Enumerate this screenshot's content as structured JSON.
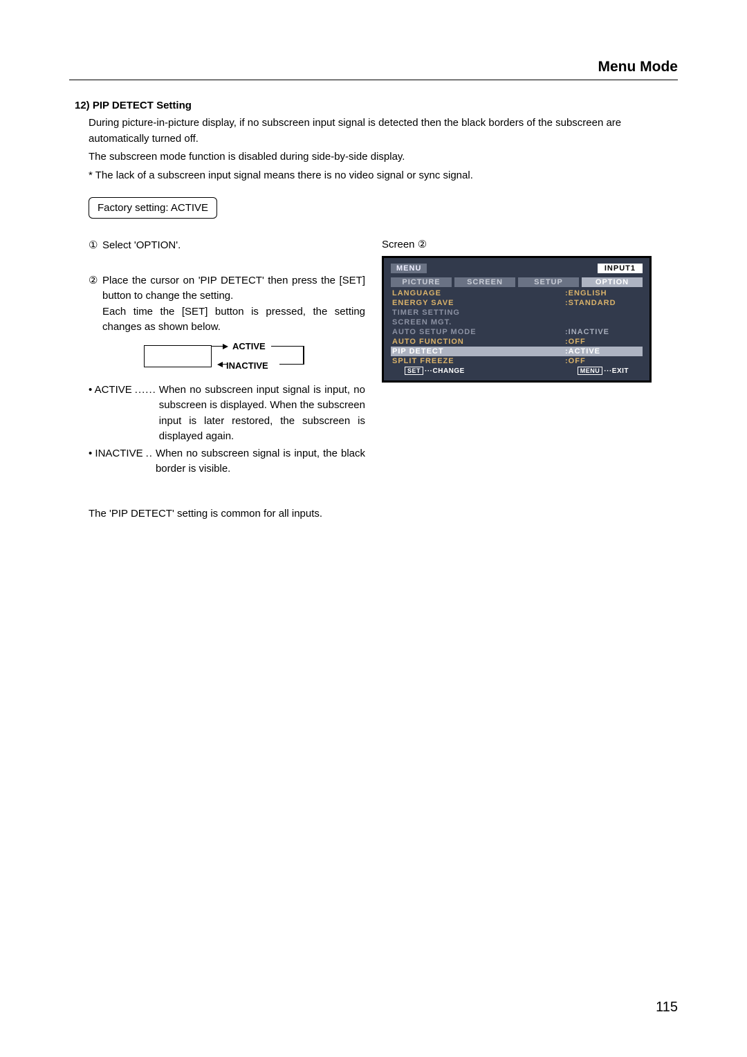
{
  "header": {
    "title": "Menu Mode"
  },
  "section": {
    "heading": "12) PIP DETECT Setting",
    "p1": "During picture-in-picture display, if no subscreen input signal is detected then the black borders of the subscreen are automatically turned off.",
    "p2": "The subscreen mode function is disabled during side-by-side display.",
    "p3": "* The lack of a subscreen input signal means there is no video signal or sync signal.",
    "factory": "Factory setting:  ACTIVE"
  },
  "steps": {
    "s1": {
      "num": "①",
      "text": "Select 'OPTION'."
    },
    "s2": {
      "num": "②",
      "l1": "Place the cursor on 'PIP DETECT' then press the [SET] button to change the setting.",
      "l2": "Each time the [SET] button is pressed, the setting changes as shown below."
    }
  },
  "cycle": {
    "top": "ACTIVE",
    "bottom": "INACTIVE"
  },
  "bullets": {
    "active": {
      "term": "• ACTIVE",
      "dots": "......",
      "def": "When no subscreen input signal is input, no subscreen is displayed. When the subscreen input is later restored, the subscreen is displayed again."
    },
    "inactive": {
      "term": "• INACTIVE",
      "dots": "..",
      "def": "When no subscreen signal is input, the black border is visible."
    }
  },
  "common_note": "The 'PIP DETECT' setting is common for all inputs.",
  "screen_label": "Screen ②",
  "osd": {
    "menu": "MENU",
    "input": "INPUT1",
    "tabs": [
      "PICTURE",
      "SCREEN",
      "SETUP",
      "OPTION"
    ],
    "rows": [
      {
        "k": "LANGUAGE",
        "v": ":ENGLISH",
        "style": "orange"
      },
      {
        "k": "ENERGY SAVE",
        "v": ":STANDARD",
        "style": "orange"
      },
      {
        "k": "TIMER SETTING",
        "v": "",
        "style": ""
      },
      {
        "k": "SCREEN MGT.",
        "v": "",
        "style": ""
      },
      {
        "k": "AUTO SETUP MODE",
        "v": ":INACTIVE",
        "style": ""
      },
      {
        "k": "AUTO FUNCTION",
        "v": ":OFF",
        "style": "orange"
      },
      {
        "k": "PIP DETECT",
        "v": ":ACTIVE",
        "style": "hl"
      },
      {
        "k": "SPLIT FREEZE",
        "v": ":OFF",
        "style": "orange"
      }
    ],
    "footer": {
      "left_btn": "SET",
      "left": "···CHANGE",
      "right_btn": "MENU",
      "right": "···EXIT"
    }
  },
  "page_number": "115"
}
